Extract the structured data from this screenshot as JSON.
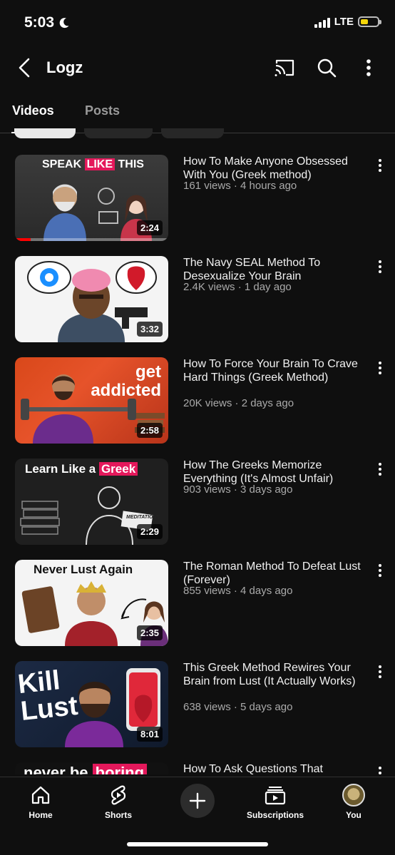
{
  "status_bar": {
    "time": "5:03",
    "network": "LTE",
    "battery_level": 0.45,
    "battery_color": "#f5d60a"
  },
  "header": {
    "title": "Logz",
    "icons": [
      "back-icon",
      "cast-icon",
      "search-icon",
      "more-vertical-icon"
    ]
  },
  "tabs": [
    {
      "label": "Videos",
      "active": true
    },
    {
      "label": "Posts",
      "active": false
    }
  ],
  "videos": [
    {
      "title": "How To Make Anyone Obsessed With You (Greek method)",
      "meta": "161 views · 4 hours ago",
      "duration": "2:24",
      "thumb_text": [
        "SPEAK",
        "LIKE",
        "THIS"
      ],
      "watched": 0.1
    },
    {
      "title": "The Navy SEAL Method To Desexualize Your Brain",
      "meta": "2.4K views · 1 day ago",
      "duration": "3:32",
      "thumb_text": []
    },
    {
      "title": "How To Force Your Brain To Crave Hard Things (Greek Method)",
      "meta": "20K views · 2 days ago",
      "duration": "2:58",
      "thumb_text": [
        "get",
        "addicted"
      ]
    },
    {
      "title": "How The Greeks Memorize Everything (It's Almost Unfair)",
      "meta": "903 views · 3 days ago",
      "duration": "2:29",
      "thumb_text": [
        "Learn Like a",
        "Greek",
        "MEDITATIONS"
      ]
    },
    {
      "title": "The Roman Method To Defeat Lust (Forever)",
      "meta": "855 views · 4 days ago",
      "duration": "2:35",
      "thumb_text": [
        "Never Lust Again"
      ]
    },
    {
      "title": "This Greek Method Rewires Your Brain from Lust (It Actually Works)",
      "meta": "638 views · 5 days ago",
      "duration": "8:01",
      "thumb_text": [
        "Kill",
        "Lust"
      ]
    },
    {
      "title": "How To Ask Questions That",
      "meta": "",
      "duration": "",
      "thumb_text": [
        "never be",
        "boring"
      ]
    }
  ],
  "bottom_nav": {
    "home": "Home",
    "shorts": "Shorts",
    "create": "",
    "subscriptions": "Subscriptions",
    "you": "You"
  },
  "colors": {
    "background": "#0f0f0f",
    "accent_red": "#ff0000",
    "highlight_pink": "#e4185b"
  }
}
